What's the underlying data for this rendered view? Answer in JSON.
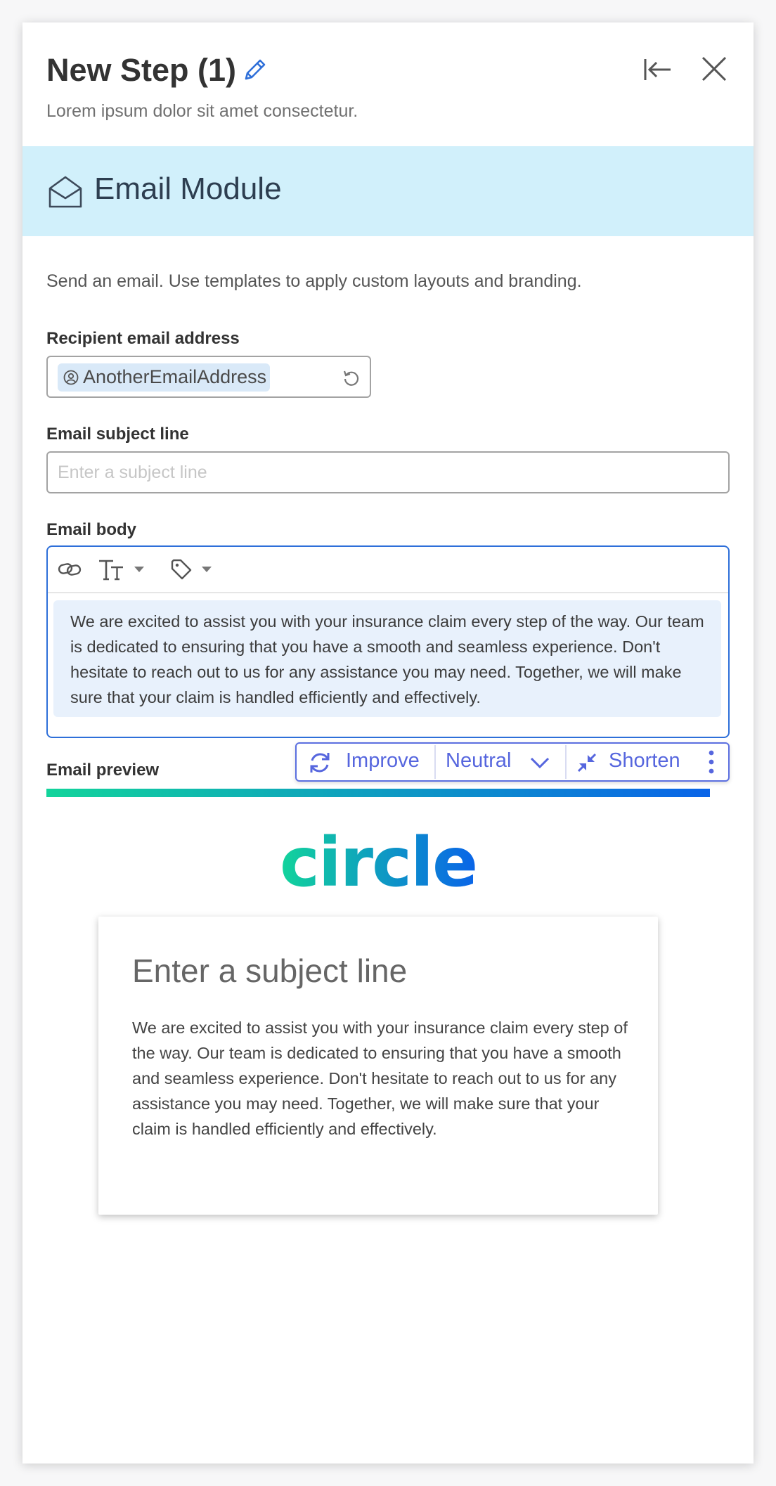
{
  "header": {
    "title": "New Step (1)",
    "subtitle": "Lorem ipsum dolor sit amet consectetur."
  },
  "module": {
    "title": "Email Module",
    "description": "Send an email. Use templates to apply custom layouts and branding."
  },
  "recipient": {
    "label": "Recipient email address",
    "chip_value": "AnotherEmailAddress"
  },
  "subject": {
    "label": "Email subject line",
    "value": "",
    "placeholder": "Enter a subject line"
  },
  "body": {
    "label": "Email body",
    "text": "We are excited to assist you with your insurance claim every step of the way. Our team is dedicated to ensuring that you have a smooth and seamless experience. Don't hesitate to reach out to us for any assistance you may need. Together, we will make sure that your claim is handled efficiently and effectively."
  },
  "ai_toolbar": {
    "improve": "Improve",
    "tone": "Neutral",
    "shorten": "Shorten"
  },
  "preview": {
    "label": "Email preview",
    "logo_text": "circle",
    "subject": "Enter a subject line",
    "body": "We are excited to assist you with your insurance claim every step of the way. Our team is dedicated to ensuring that you have a smooth and seamless experience. Don't hesitate to reach out to us for any assistance you may need. Together, we will make sure that your claim is handled efficiently and effectively."
  },
  "colors": {
    "accent_blue": "#2e6fd9",
    "module_header_bg": "#d1f0fb",
    "ai_purple": "#5666de",
    "gradient_start": "#12d49b",
    "gradient_end": "#0a64e8"
  },
  "icons": [
    "pencil-icon",
    "collapse-left-icon",
    "close-icon",
    "envelope-icon",
    "user-circle-icon",
    "reset-icon",
    "link-icon",
    "text-size-icon",
    "tag-icon",
    "refresh-icon",
    "chevron-down-icon",
    "compress-icon",
    "more-vertical-icon"
  ]
}
